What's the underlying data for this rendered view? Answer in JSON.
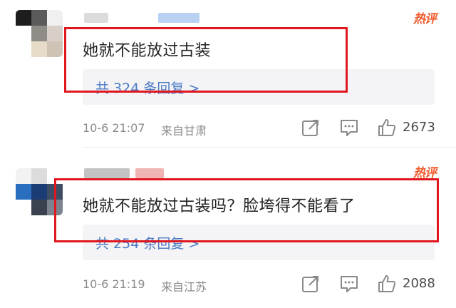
{
  "comments": [
    {
      "text": "她就不能放过古装",
      "reply_link": "共 324 条回复 >",
      "time": "10-6 21:07",
      "location": "来自甘肃",
      "likes": "2673",
      "hot_label": "热评"
    },
    {
      "text": "她就不能放过古装吗？脸垮得不能看了",
      "reply_link": "共 254 条回复 >",
      "time": "10-6 21:19",
      "location": "来自江苏",
      "likes": "2088",
      "hot_label": "热评"
    }
  ],
  "colors": {
    "highlight_frame": "#e0171f",
    "hot_badge": "#f15a2b",
    "reply_link": "#4b7ac4",
    "meta_text": "#8b8b8b"
  },
  "icons": [
    "share-icon",
    "comment-icon",
    "thumbs-up-icon"
  ]
}
